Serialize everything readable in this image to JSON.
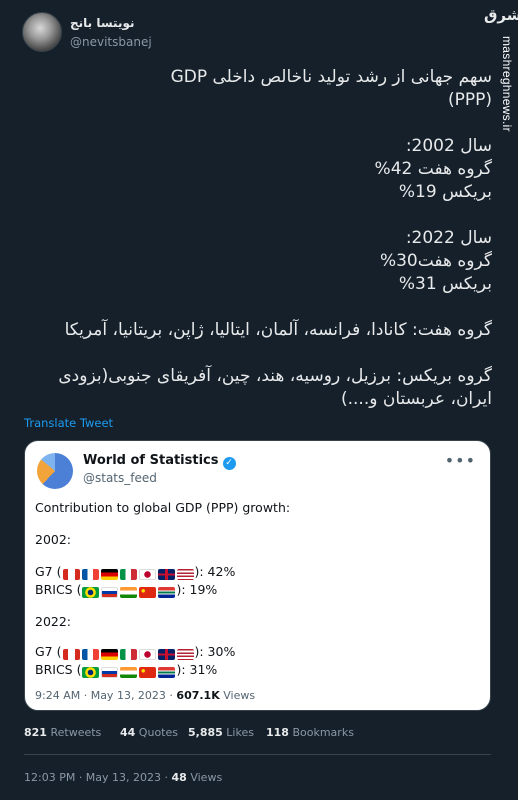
{
  "author": {
    "name": "نویتسا بانج",
    "handle": "@nevitsbanej"
  },
  "watermark": {
    "logo": "مشرق",
    "site": "mashreghnews.ir"
  },
  "tweet": {
    "lines": [
      "سهم جهانی از رشد تولید ناخالص داخلی GDP",
      "(PPP)",
      "",
      "سال 2002:",
      "گروه هفت 42%",
      "بریکس 19%",
      "",
      "سال 2022:",
      "گروه هفت30%",
      "بریکس 31%",
      "",
      "گروه هفت: کانادا، فرانسه، آلمان، ایتالیا، ژاپن، بریتانیا، آمریکا",
      "",
      "گروه بریکس: برزیل، روسیه، هند، چین، آفریقای جنوبی(بزودی",
      "ایران، عربستان و....)"
    ],
    "translate_label": "Translate Tweet"
  },
  "quoted_tweet": {
    "name": "World of Statistics",
    "handle": "@stats_feed",
    "more_label": "•••",
    "title": "Contribution to global GDP (PPP) growth:",
    "year_2002": "2002:",
    "g7_prefix": "G7 (",
    "g7_2002_suffix": "): 42%",
    "brics_prefix": "BRICS (",
    "brics_2002_suffix": "): 19%",
    "year_2022": "2022:",
    "g7_2022_suffix": "): 30%",
    "brics_2022_suffix": "): 31%",
    "time": "9:24 AM · May 13, 2023 · ",
    "views_count": "607.1K",
    "views_label": " Views"
  },
  "stats": {
    "retweets_count": "821",
    "retweets_label": " Retweets",
    "quotes_count": "44",
    "quotes_label": " Quotes",
    "likes_count": "5,885",
    "likes_label": " Likes",
    "bookmarks_count": "118",
    "bookmarks_label": " Bookmarks"
  },
  "footer": {
    "time": "12:03 PM · May 13, 2023 · ",
    "views_count": "48",
    "views_label": " Views"
  },
  "colors": {
    "background": "#15202b",
    "accent": "#1d9bf0",
    "card_bg": "#ffffff"
  }
}
